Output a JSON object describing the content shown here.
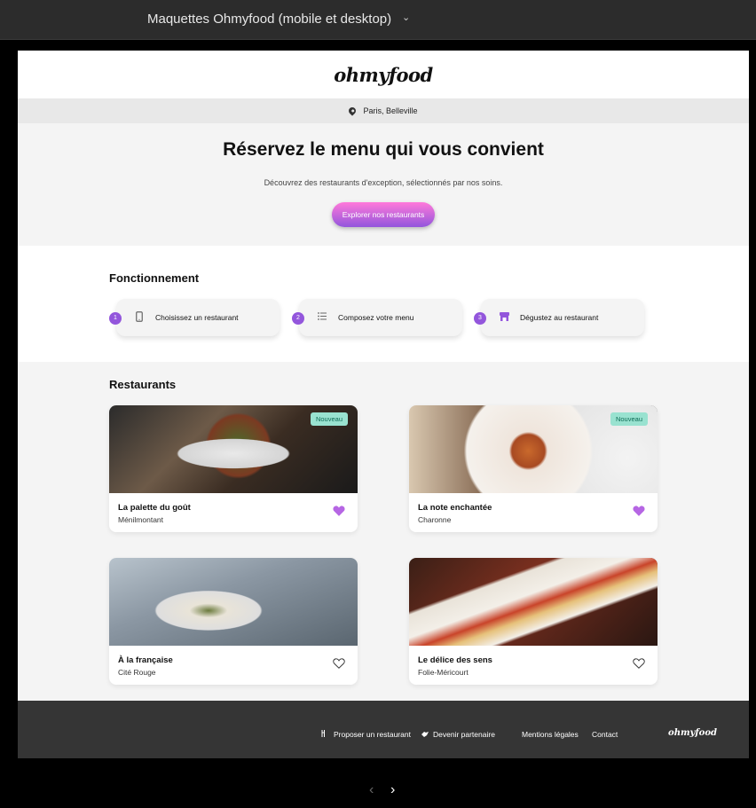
{
  "window": {
    "title": "Maquettes Ohmyfood (mobile et desktop)"
  },
  "header": {
    "logo": "ohmyfood"
  },
  "location": {
    "text": "Paris, Belleville"
  },
  "hero": {
    "title": "Réservez le menu qui vous convient",
    "subtitle": "Découvrez des restaurants d'exception, sélectionnés par nos soins.",
    "cta": "Explorer nos restaurants"
  },
  "how": {
    "title": "Fonctionnement",
    "steps": [
      {
        "num": "1",
        "icon": "phone-icon",
        "label": "Choisissez un restaurant"
      },
      {
        "num": "2",
        "icon": "list-icon",
        "label": "Composez votre menu"
      },
      {
        "num": "3",
        "icon": "store-icon",
        "label": "Dégustez au restaurant"
      }
    ]
  },
  "restaurants": {
    "title": "Restaurants",
    "cards": [
      {
        "name": "La palette du goût",
        "area": "Ménilmontant",
        "badge": "Nouveau",
        "liked": true
      },
      {
        "name": "La note enchantée",
        "area": "Charonne",
        "badge": "Nouveau",
        "liked": true
      },
      {
        "name": "À la française",
        "area": "Cité Rouge",
        "badge": "",
        "liked": false
      },
      {
        "name": "Le délice des sens",
        "area": "Folie-Méricourt",
        "badge": "",
        "liked": false
      }
    ]
  },
  "footer": {
    "propose": "Proposer un restaurant",
    "partner": "Devenir partenaire",
    "legal": "Mentions légales",
    "contact": "Contact",
    "logo": "ohmyfood"
  },
  "colors": {
    "accent": "#9356dc",
    "badge": "#99e2d0",
    "footer": "#353535"
  }
}
